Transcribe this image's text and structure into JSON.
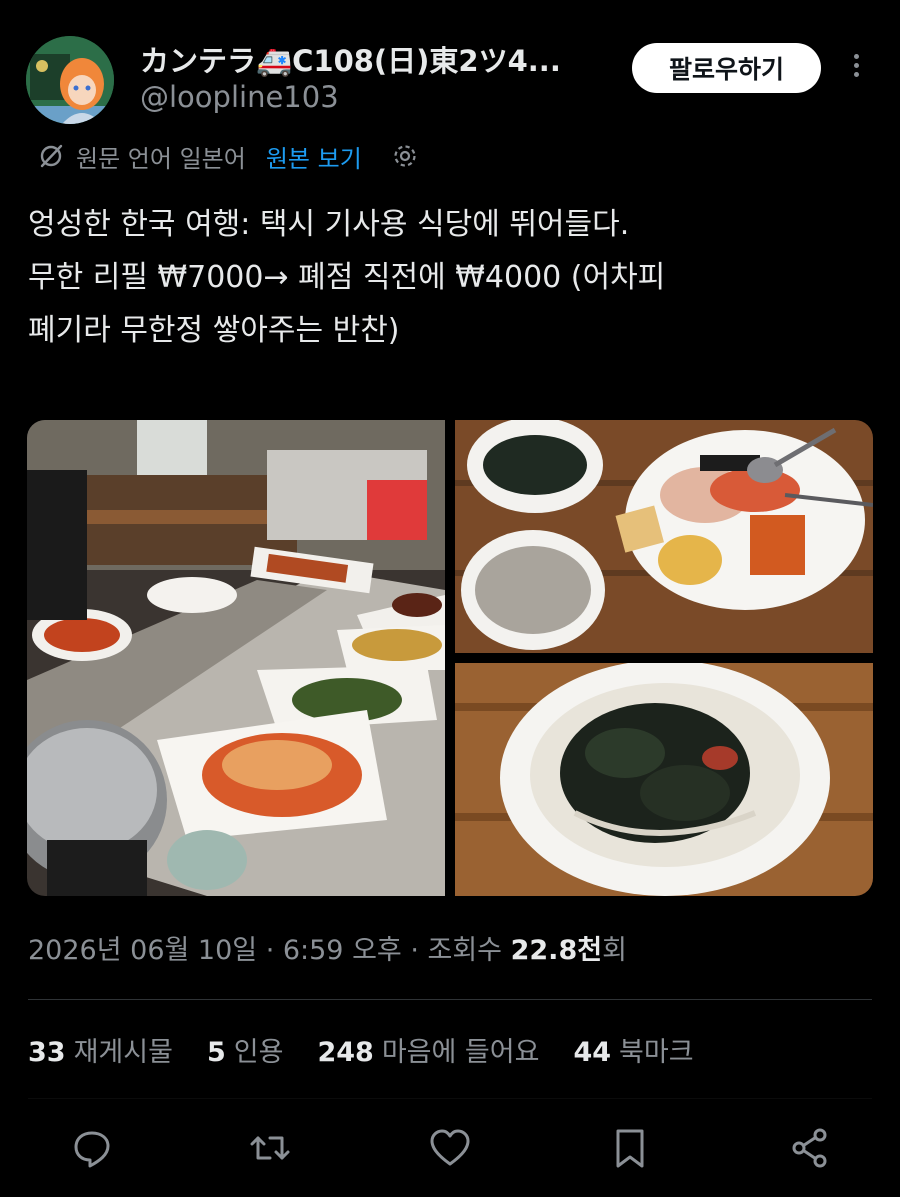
{
  "user": {
    "display_name": "カンテラ🚑C108(日)東2ツ4...",
    "handle": "@loopline103",
    "follow_label": "팔로우하기"
  },
  "translation": {
    "source_language": "원문 언어 일본어",
    "view_original": "원본 보기"
  },
  "tweet": {
    "lines": [
      "엉성한 한국 여행: 택시 기사용 식당에 뛰어들다.",
      "무한 리필 ₩7000→ 폐점 직전에 ₩4000 (어차피",
      "폐기라 무한정 쌓아주는 반찬)"
    ]
  },
  "meta": {
    "date": "2026년 06월 10일 · 6:59 오후 · 조회수 ",
    "views": "22.8천",
    "views_suffix": "회"
  },
  "stats": [
    {
      "count": "33",
      "label": "재게시물"
    },
    {
      "count": "5",
      "label": "인용"
    },
    {
      "count": "248",
      "label": "마음에 들어요"
    },
    {
      "count": "44",
      "label": "북마크"
    }
  ],
  "icons": {
    "reply": "reply-icon",
    "repost": "repost-icon",
    "like": "heart-icon",
    "bookmark": "bookmark-icon",
    "share": "share-icon"
  },
  "colors": {
    "background": "#000000",
    "text": "#e7e9ea",
    "secondary": "#8b9096",
    "link": "#1d9bf0"
  }
}
